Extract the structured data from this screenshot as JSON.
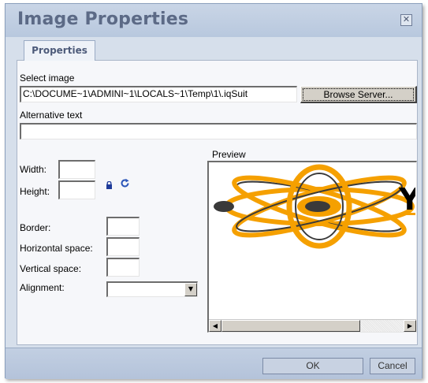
{
  "dialog": {
    "title": "Image Properties",
    "close_icon": "close-icon"
  },
  "tabs": [
    {
      "label": "Properties",
      "active": true
    }
  ],
  "form": {
    "select_image_label": "Select image",
    "select_image_value": "C:\\DOCUME~1\\ADMINI~1\\LOCALS~1\\Temp\\1\\.iqSuit",
    "browse_button": "Browse Server...",
    "alt_text_label": "Alternative text",
    "alt_text_value": "",
    "width_label": "Width:",
    "width_value": "",
    "height_label": "Height:",
    "height_value": "",
    "lock_icon": "lock-icon",
    "reset_icon": "reset-size-icon",
    "border_label": "Border:",
    "border_value": "",
    "hspace_label": "Horizontal space:",
    "hspace_value": "",
    "vspace_label": "Vertical space:",
    "vspace_value": "",
    "alignment_label": "Alignment:",
    "alignment_value": ""
  },
  "preview": {
    "label": "Preview",
    "logo_text": "Y"
  },
  "footer": {
    "ok_label": "OK",
    "cancel_label": "Cancel"
  },
  "colors": {
    "dialog_bg": "#d6dfeb",
    "title_text": "#5c6a86",
    "logo_orange": "#f5a000"
  }
}
